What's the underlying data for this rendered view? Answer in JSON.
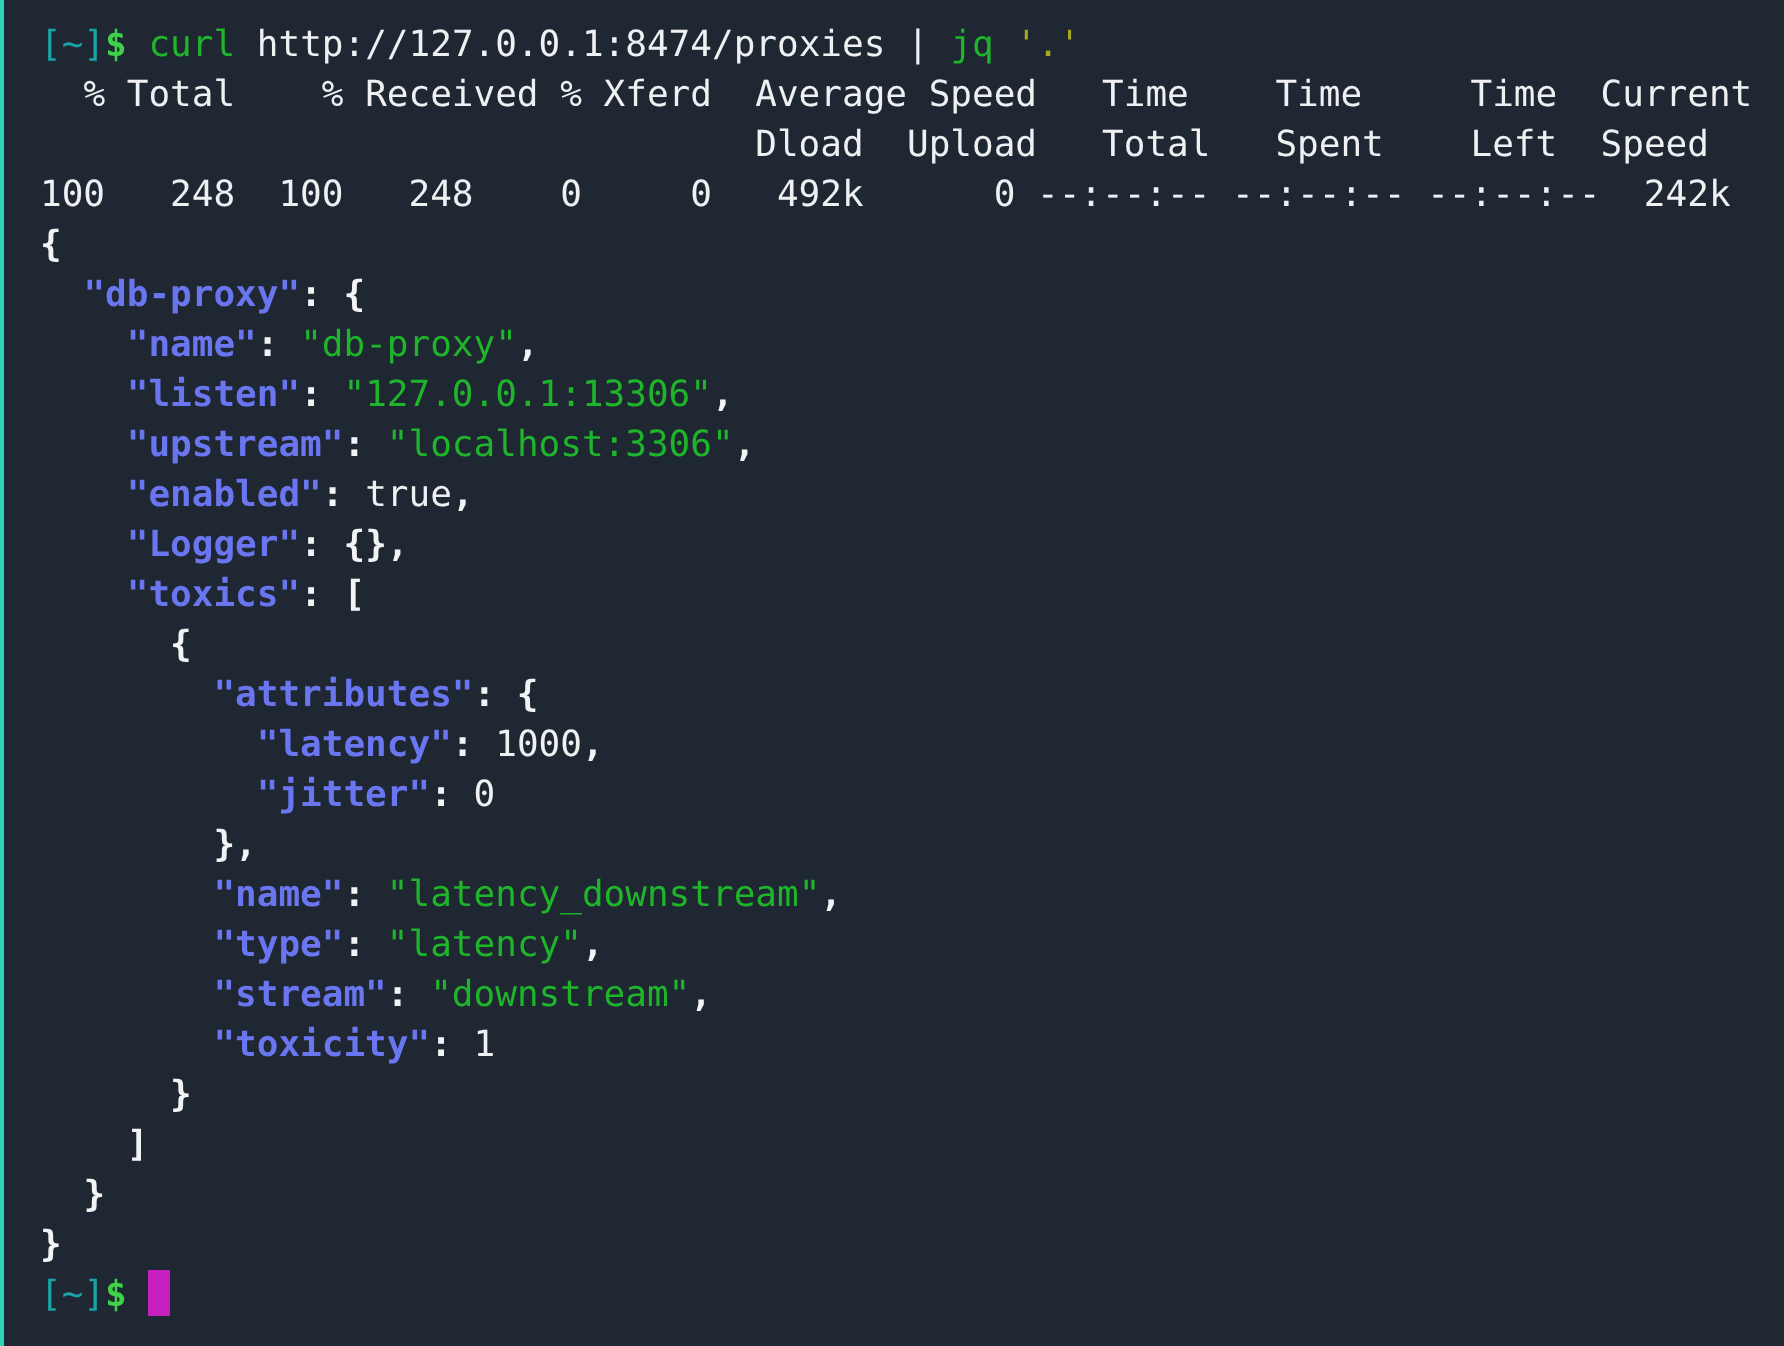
{
  "terminal": {
    "lines": [
      {
        "segments": [
          {
            "text": "[~]",
            "kind": "prompt"
          },
          {
            "text": "$ ",
            "kind": "dollar"
          },
          {
            "text": "curl ",
            "kind": "command"
          },
          {
            "text": "http://127.0.0.1:8474/proxies | ",
            "kind": "text"
          },
          {
            "text": "jq ",
            "kind": "command"
          },
          {
            "text": "'.'",
            "kind": "argument"
          }
        ]
      },
      {
        "segments": [
          {
            "text": "  % Total    % Received % Xferd  Average Speed   Time    Time     Time  Current",
            "kind": "progress"
          }
        ]
      },
      {
        "segments": [
          {
            "text": "                                 Dload  Upload   Total   Spent    Left  Speed",
            "kind": "progress"
          }
        ]
      },
      {
        "segments": [
          {
            "text": "100   248  100   248    0     0   492k      0 --:--:-- --:--:-- --:--:--  242k",
            "kind": "progress"
          }
        ]
      },
      {
        "segments": [
          {
            "text": "{",
            "kind": "punct"
          }
        ]
      },
      {
        "segments": [
          {
            "text": "  \"db-proxy\"",
            "kind": "key"
          },
          {
            "text": ": {",
            "kind": "punct"
          }
        ]
      },
      {
        "segments": [
          {
            "text": "    \"name\"",
            "kind": "key"
          },
          {
            "text": ": ",
            "kind": "punct"
          },
          {
            "text": "\"db-proxy\"",
            "kind": "string"
          },
          {
            "text": ",",
            "kind": "punct"
          }
        ]
      },
      {
        "segments": [
          {
            "text": "    \"listen\"",
            "kind": "key"
          },
          {
            "text": ": ",
            "kind": "punct"
          },
          {
            "text": "\"127.0.0.1:13306\"",
            "kind": "string"
          },
          {
            "text": ",",
            "kind": "punct"
          }
        ]
      },
      {
        "segments": [
          {
            "text": "    \"upstream\"",
            "kind": "key"
          },
          {
            "text": ": ",
            "kind": "punct"
          },
          {
            "text": "\"localhost:3306\"",
            "kind": "string"
          },
          {
            "text": ",",
            "kind": "punct"
          }
        ]
      },
      {
        "segments": [
          {
            "text": "    \"enabled\"",
            "kind": "key"
          },
          {
            "text": ": ",
            "kind": "punct"
          },
          {
            "text": "true",
            "kind": "value"
          },
          {
            "text": ",",
            "kind": "punct"
          }
        ]
      },
      {
        "segments": [
          {
            "text": "    \"Logger\"",
            "kind": "key"
          },
          {
            "text": ": {},",
            "kind": "punct"
          }
        ]
      },
      {
        "segments": [
          {
            "text": "    \"toxics\"",
            "kind": "key"
          },
          {
            "text": ": [",
            "kind": "punct"
          }
        ]
      },
      {
        "segments": [
          {
            "text": "      {",
            "kind": "punct"
          }
        ]
      },
      {
        "segments": [
          {
            "text": "        \"attributes\"",
            "kind": "key"
          },
          {
            "text": ": {",
            "kind": "punct"
          }
        ]
      },
      {
        "segments": [
          {
            "text": "          \"latency\"",
            "kind": "key"
          },
          {
            "text": ": ",
            "kind": "punct"
          },
          {
            "text": "1000",
            "kind": "value"
          },
          {
            "text": ",",
            "kind": "punct"
          }
        ]
      },
      {
        "segments": [
          {
            "text": "          \"jitter\"",
            "kind": "key"
          },
          {
            "text": ": ",
            "kind": "punct"
          },
          {
            "text": "0",
            "kind": "value"
          }
        ]
      },
      {
        "segments": [
          {
            "text": "        },",
            "kind": "punct"
          }
        ]
      },
      {
        "segments": [
          {
            "text": "        \"name\"",
            "kind": "key"
          },
          {
            "text": ": ",
            "kind": "punct"
          },
          {
            "text": "\"latency_downstream\"",
            "kind": "string"
          },
          {
            "text": ",",
            "kind": "punct"
          }
        ]
      },
      {
        "segments": [
          {
            "text": "        \"type\"",
            "kind": "key"
          },
          {
            "text": ": ",
            "kind": "punct"
          },
          {
            "text": "\"latency\"",
            "kind": "string"
          },
          {
            "text": ",",
            "kind": "punct"
          }
        ]
      },
      {
        "segments": [
          {
            "text": "        \"stream\"",
            "kind": "key"
          },
          {
            "text": ": ",
            "kind": "punct"
          },
          {
            "text": "\"downstream\"",
            "kind": "string"
          },
          {
            "text": ",",
            "kind": "punct"
          }
        ]
      },
      {
        "segments": [
          {
            "text": "        \"toxicity\"",
            "kind": "key"
          },
          {
            "text": ": ",
            "kind": "punct"
          },
          {
            "text": "1",
            "kind": "value"
          }
        ]
      },
      {
        "segments": [
          {
            "text": "      }",
            "kind": "punct"
          }
        ]
      },
      {
        "segments": [
          {
            "text": "    ]",
            "kind": "punct"
          }
        ]
      },
      {
        "segments": [
          {
            "text": "  }",
            "kind": "punct"
          }
        ]
      },
      {
        "segments": [
          {
            "text": "}",
            "kind": "punct"
          }
        ]
      },
      {
        "segments": [
          {
            "text": "[~]",
            "kind": "prompt"
          },
          {
            "text": "$ ",
            "kind": "dollar"
          }
        ],
        "cursor": true
      }
    ]
  }
}
